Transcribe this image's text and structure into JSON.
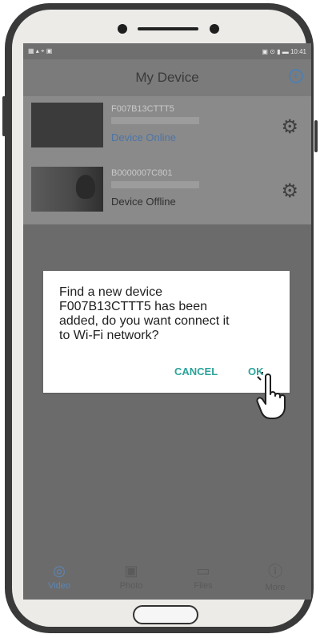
{
  "statusbar": {
    "left_icons": "▦ ▴ ⌖ ▣",
    "right_text": "▣ ⊙ ▮ ▬ 10:41"
  },
  "app": {
    "title": "My Device",
    "add_icon": "+"
  },
  "devices": [
    {
      "id": "F007B13CTTT5",
      "status": "Device Online"
    },
    {
      "id": "B0000007C801",
      "status": "Device Offline"
    }
  ],
  "dialog": {
    "message": "Find a new device\nF007B13CTTT5 has been\nadded, do you want connect it\nto Wi-Fi network?",
    "cancel": "CANCEL",
    "ok": "OK"
  },
  "tabs": [
    {
      "label": "Video",
      "icon": "webcam-icon"
    },
    {
      "label": "Photo",
      "icon": "photo-icon"
    },
    {
      "label": "Files",
      "icon": "camera-file-icon"
    },
    {
      "label": "More",
      "icon": "info-icon"
    }
  ],
  "colors": {
    "accent_teal": "#2ba39a",
    "accent_blue": "#4d74a6",
    "dim_overlay": "#6b6b6b"
  }
}
